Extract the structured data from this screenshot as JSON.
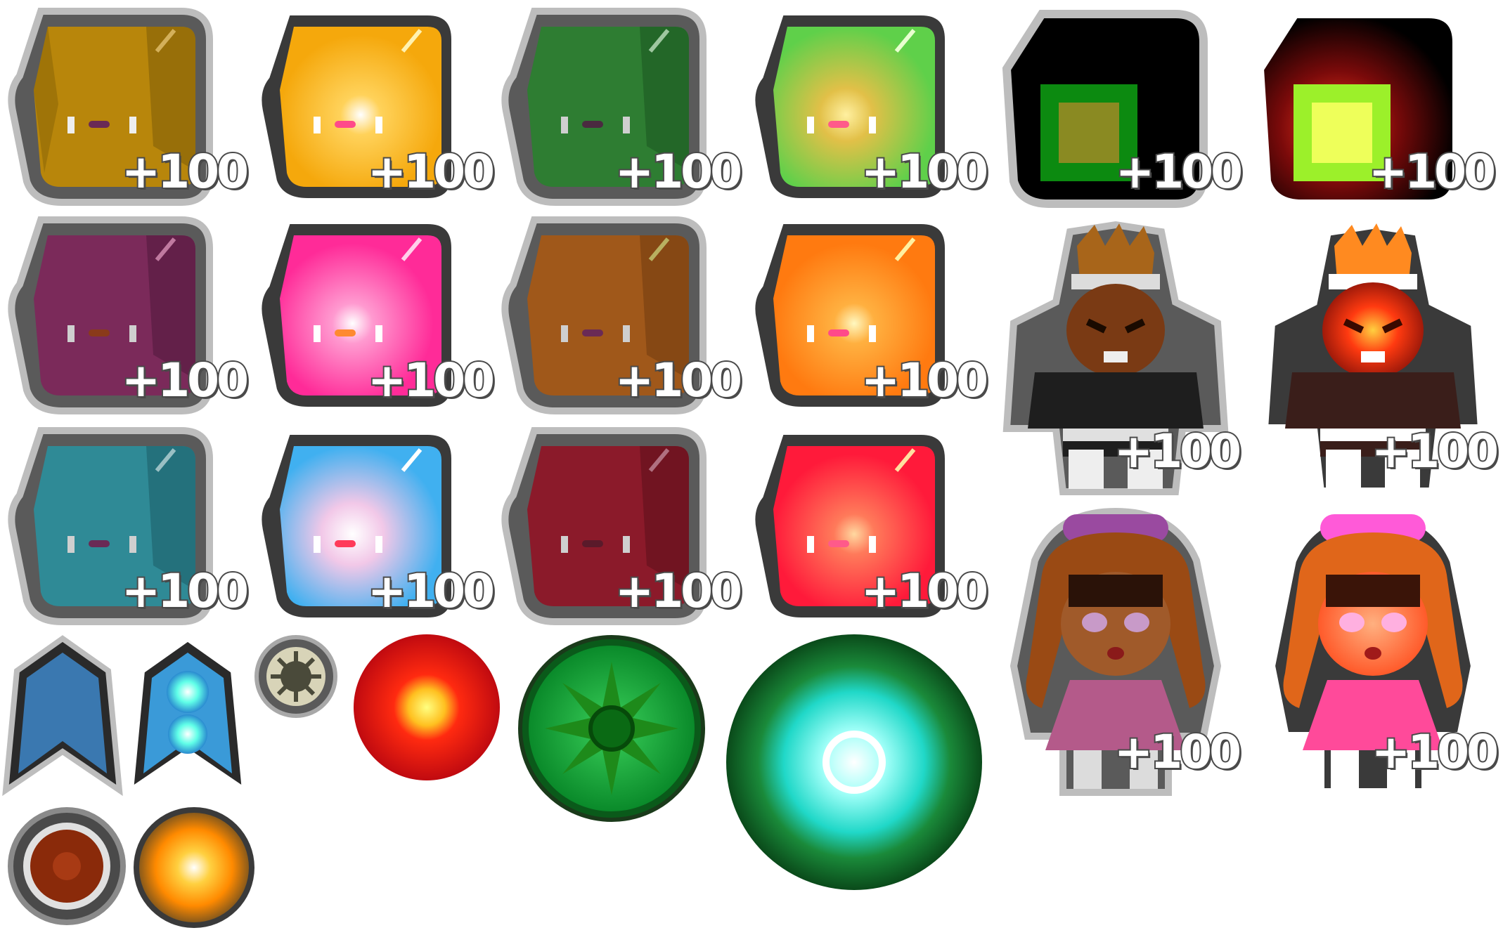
{
  "score_label": "+100",
  "palette": {
    "olive": "#b8860b",
    "amber": "#f5b81c",
    "forest": "#2e7d32",
    "lime": "#7ed957",
    "plum": "#7b2a5a",
    "pink": "#ff3fa4",
    "brown": "#a0581a",
    "orange": "#ff8c1a",
    "teal": "#2f8a96",
    "ice": "#a8e4ff",
    "maroon": "#8b1a2a",
    "red": "#ff2a45"
  },
  "sprites": [
    {
      "kind": "cube",
      "color": "olive",
      "lit": false
    },
    {
      "kind": "cube",
      "color": "amber",
      "lit": true
    },
    {
      "kind": "cube",
      "color": "forest",
      "lit": false
    },
    {
      "kind": "cube",
      "color": "lime",
      "lit": true
    },
    {
      "kind": "switch",
      "lit": false
    },
    {
      "kind": "switch",
      "lit": true
    },
    {
      "kind": "cube",
      "color": "plum",
      "lit": false
    },
    {
      "kind": "cube",
      "color": "pink",
      "lit": true
    },
    {
      "kind": "cube",
      "color": "brown",
      "lit": false
    },
    {
      "kind": "cube",
      "color": "orange",
      "lit": true
    },
    {
      "kind": "cube",
      "color": "teal",
      "lit": false
    },
    {
      "kind": "cube",
      "color": "ice",
      "lit": true
    },
    {
      "kind": "cube",
      "color": "maroon",
      "lit": false
    },
    {
      "kind": "cube",
      "color": "red",
      "lit": true
    },
    {
      "kind": "soldier",
      "lit": false
    },
    {
      "kind": "soldier",
      "lit": true
    },
    {
      "kind": "girl",
      "lit": false
    },
    {
      "kind": "girl",
      "lit": true
    },
    {
      "kind": "shield",
      "lit": false
    },
    {
      "kind": "shield",
      "lit": true
    },
    {
      "kind": "orb",
      "color": "gray",
      "lit": false
    },
    {
      "kind": "orb",
      "color": "red",
      "lit": true
    },
    {
      "kind": "orb",
      "color": "green",
      "lit": false
    },
    {
      "kind": "orb",
      "color": "cyan",
      "lit": true
    },
    {
      "kind": "orb",
      "color": "rust",
      "lit": false
    },
    {
      "kind": "orb",
      "color": "gold",
      "lit": true
    }
  ]
}
